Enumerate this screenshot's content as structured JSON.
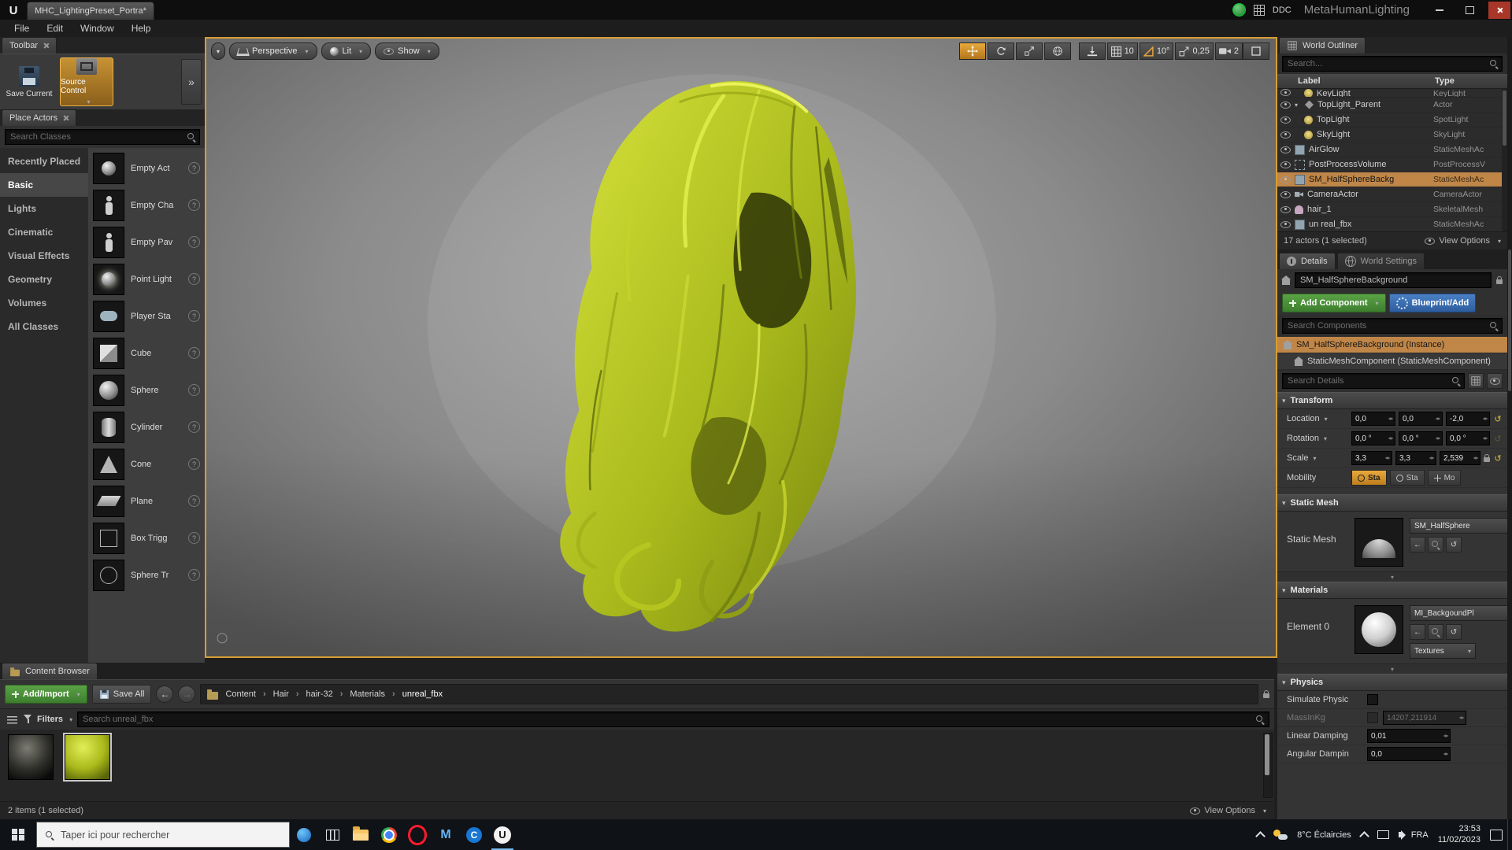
{
  "colors": {
    "accent_orange": "#e9a93c",
    "selection_tan": "#bf8648",
    "viewport_border": "#d79e33",
    "green_button": "#3c7e2e",
    "blue_button": "#2d5d9e",
    "hair_main": "#aaba1c",
    "hair_highlight": "#e4f04e",
    "hair_shadow": "#333b08"
  },
  "window": {
    "tab_label": "MHC_LightingPreset_Portra*",
    "ddc_label": "DDC",
    "app_title": "MetaHumanLighting"
  },
  "menu": {
    "items": [
      "File",
      "Edit",
      "Window",
      "Help"
    ]
  },
  "toolbar": {
    "tab_label": "Toolbar",
    "save_current_label": "Save Current",
    "source_control_label": "Source Control"
  },
  "place_actors": {
    "tab_label": "Place Actors",
    "search_placeholder": "Search Classes",
    "categories": [
      "Recently Placed",
      "Basic",
      "Lights",
      "Cinematic",
      "Visual Effects",
      "Geometry",
      "Volumes",
      "All Classes"
    ],
    "items": [
      "Empty Act",
      "Empty Cha",
      "Empty Pav",
      "Point Light",
      "Player Sta",
      "Cube",
      "Sphere",
      "Cylinder",
      "Cone",
      "Plane",
      "Box Trigg",
      "Sphere Tr"
    ]
  },
  "viewport": {
    "perspective_label": "Perspective",
    "lit_label": "Lit",
    "show_label": "Show",
    "grid_snap": "10",
    "angle_snap": "10°",
    "scale_snap": "0,25",
    "camera_speed": "2"
  },
  "outliner": {
    "tab_label": "World Outliner",
    "search_placeholder": "Search...",
    "col_label": "Label",
    "col_type": "Type",
    "rows": [
      {
        "label": "KeyLight",
        "type": "KeyLight"
      },
      {
        "label": "TopLight_Parent",
        "type": "Actor"
      },
      {
        "label": "TopLight",
        "type": "SpotLight"
      },
      {
        "label": "SkyLight",
        "type": "SkyLight"
      },
      {
        "label": "AirGlow",
        "type": "StaticMeshAc"
      },
      {
        "label": "PostProcessVolume",
        "type": "PostProcessV"
      },
      {
        "label": "SM_HalfSphereBackg",
        "type": "StaticMeshAc"
      },
      {
        "label": "CameraActor",
        "type": "CameraActor"
      },
      {
        "label": "hair_1",
        "type": "SkeletalMesh"
      },
      {
        "label": "un real_fbx",
        "type": "StaticMeshAc"
      }
    ],
    "status": "17 actors (1 selected)",
    "view_options_label": "View Options"
  },
  "details": {
    "tab_details": "Details",
    "tab_world_settings": "World Settings",
    "object_name": "SM_HalfSphereBackground",
    "add_component_label": "Add Component",
    "blueprint_label": "Blueprint/Add",
    "search_components_placeholder": "Search Components",
    "component_instance": "SM_HalfSphereBackground (Instance)",
    "component_static_mesh": "StaticMeshComponent (StaticMeshComponent)",
    "search_details_placeholder": "Search Details",
    "transform_header": "Transform",
    "location_label": "Location",
    "location_x": "0,0",
    "location_y": "0,0",
    "location_z": "-2,0",
    "rotation_label": "Rotation",
    "rotation_x": "0,0 °",
    "rotation_y": "0,0 °",
    "rotation_z": "0,0 °",
    "scale_label": "Scale",
    "scale_x": "3,3",
    "scale_y": "3,3",
    "scale_z": "2,539",
    "mobility_label": "Mobility",
    "mobility_static": "Sta",
    "mobility_stationary": "Sta",
    "mobility_movable": "Mo",
    "static_mesh_header": "Static Mesh",
    "static_mesh_label": "Static Mesh",
    "static_mesh_value": "SM_HalfSphere",
    "materials_header": "Materials",
    "element0_label": "Element 0",
    "element0_value": "MI_BackgoundPl",
    "textures_label": "Textures",
    "physics_header": "Physics",
    "simulate_label": "Simulate Physic",
    "mass_label": "MassInKg",
    "mass_value": "14207,211914",
    "linear_damping_label": "Linear Damping",
    "linear_damping_value": "0,01",
    "angular_damping_label": "Angular Dampin",
    "angular_damping_value": "0,0"
  },
  "content_browser": {
    "tab_label": "Content Browser",
    "add_import_label": "Add/Import",
    "save_all_label": "Save All",
    "breadcrumbs": [
      "Content",
      "Hair",
      "hair-32",
      "Materials",
      "unreal_fbx"
    ],
    "filters_label": "Filters",
    "search_placeholder": "Search unreal_fbx",
    "status": "2 items (1 selected)",
    "view_options_label": "View Options"
  },
  "taskbar": {
    "search_placeholder": "Taper ici pour rechercher",
    "weather_label": "8°C Éclaircies",
    "lang_label": "FRA",
    "time": "23:53",
    "date": "11/02/2023"
  }
}
